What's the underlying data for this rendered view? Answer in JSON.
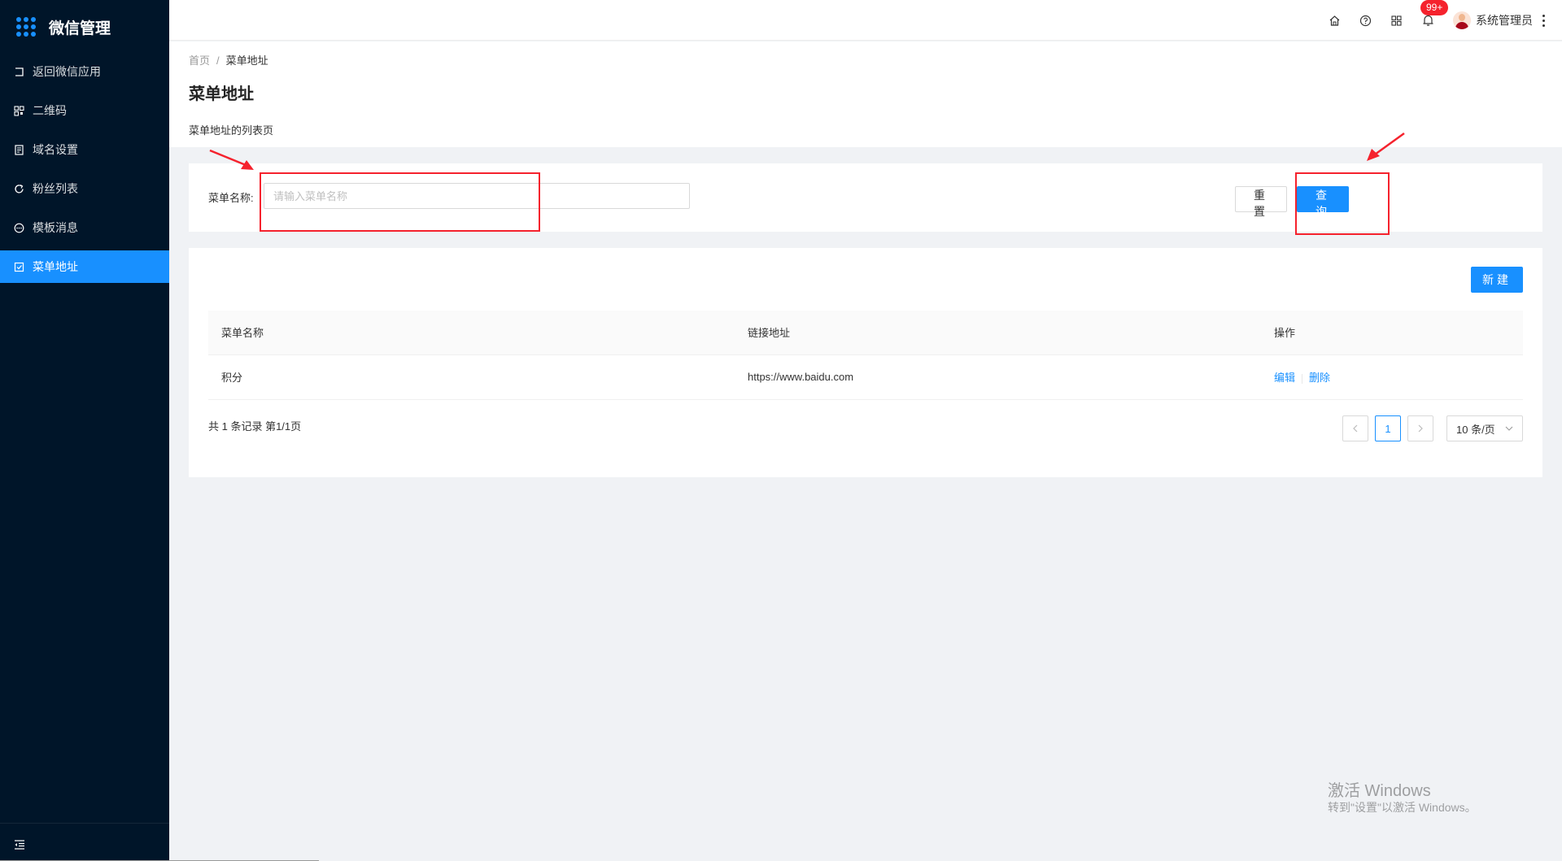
{
  "app": {
    "title": "微信管理"
  },
  "sidebar": {
    "items": [
      {
        "label": "返回微信应用",
        "icon": "return-icon"
      },
      {
        "label": "二维码",
        "icon": "qrcode-icon"
      },
      {
        "label": "域名设置",
        "icon": "document-icon"
      },
      {
        "label": "粉丝列表",
        "icon": "refresh-icon"
      },
      {
        "label": "模板消息",
        "icon": "message-icon"
      },
      {
        "label": "菜单地址",
        "icon": "checkbox-icon",
        "active": true
      }
    ]
  },
  "header": {
    "badge": "99+",
    "username": "系统管理员"
  },
  "breadcrumb": {
    "home": "首页",
    "sep": "/",
    "current": "菜单地址"
  },
  "page": {
    "title": "菜单地址",
    "description": "菜单地址的列表页"
  },
  "search": {
    "label": "菜单名称:",
    "placeholder": "请输入菜单名称",
    "reset_label": "重置",
    "query_label": "查询"
  },
  "table": {
    "new_label": "新建",
    "columns": [
      "菜单名称",
      "链接地址",
      "操作"
    ],
    "rows": [
      {
        "name": "积分",
        "url": "https://www.baidu.com",
        "edit": "编辑",
        "delete": "删除"
      }
    ]
  },
  "pagination": {
    "total_text": "共 1 条记录 第1/1页",
    "current_page": "1",
    "page_size": "10 条/页"
  },
  "watermark": {
    "line1": "激活 Windows",
    "line2": "转到\"设置\"以激活 Windows。"
  },
  "colors": {
    "primary": "#1890ff",
    "sidebar": "#001529",
    "annotation": "#f5222d"
  }
}
